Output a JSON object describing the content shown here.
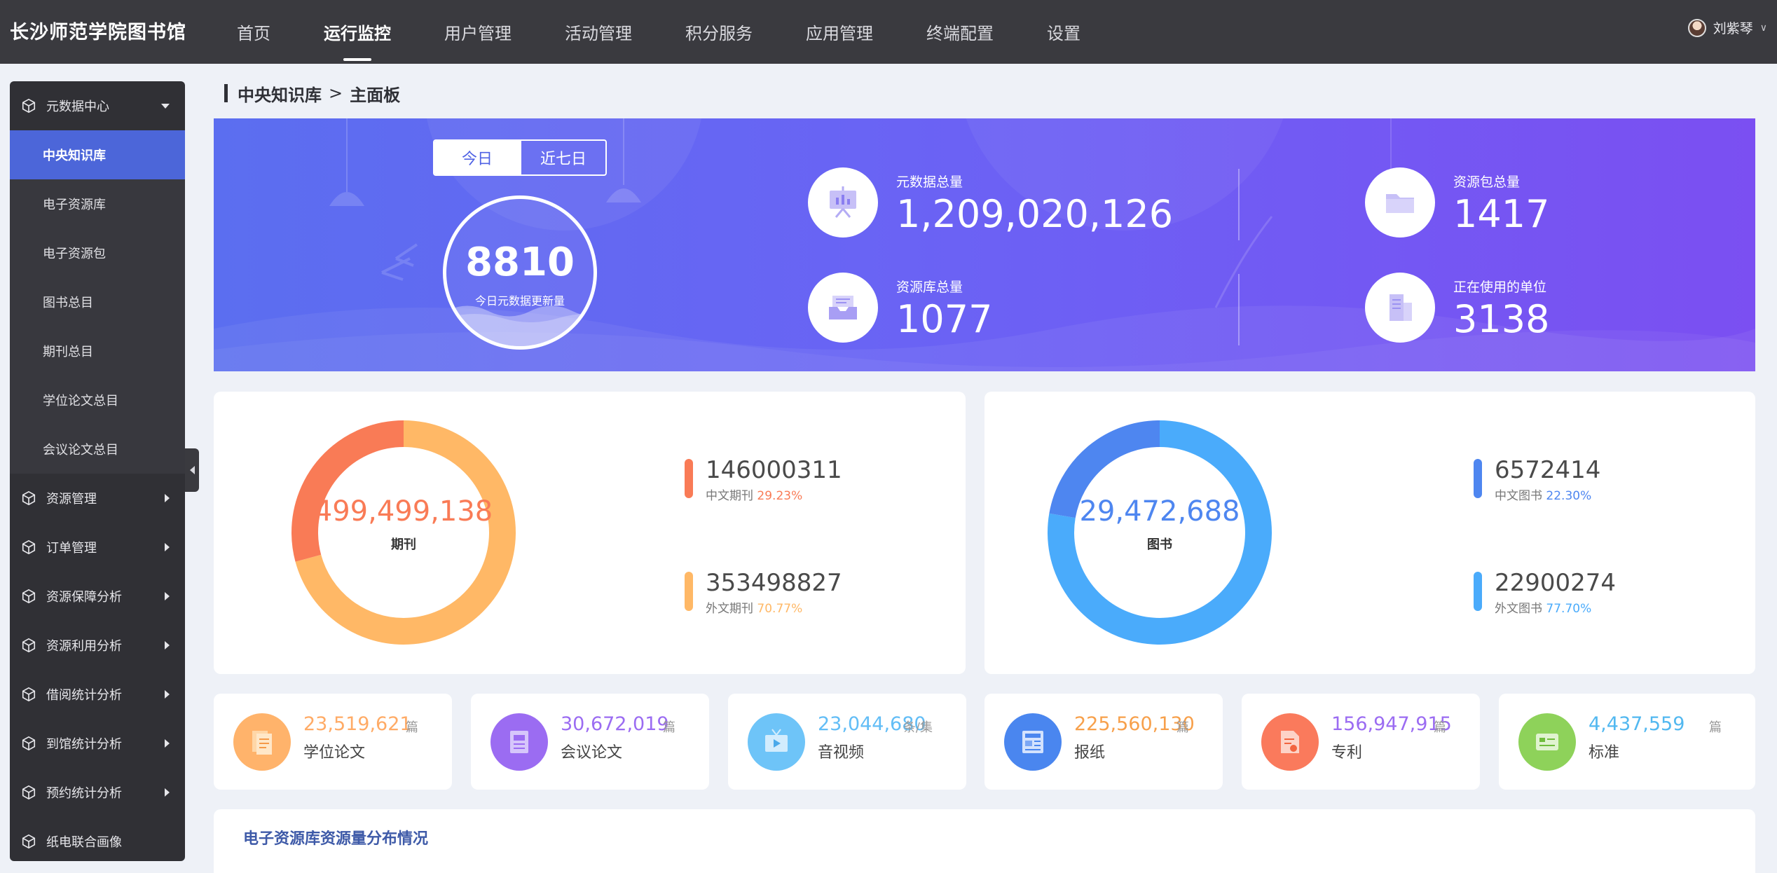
{
  "brand": "长沙师范学院图书馆",
  "nav": [
    "首页",
    "运行监控",
    "用户管理",
    "活动管理",
    "积分服务",
    "应用管理",
    "终端配置",
    "设置"
  ],
  "user": {
    "name": "刘紫琴"
  },
  "sidebar": {
    "group_open": "元数据中心",
    "sub_items": [
      "中央知识库",
      "电子资源库",
      "电子资源包",
      "图书总目",
      "期刊总目",
      "学位论文总目",
      "会议论文总目"
    ],
    "items": [
      "资源管理",
      "订单管理",
      "资源保障分析",
      "资源利用分析",
      "借阅统计分析",
      "到馆统计分析",
      "预约统计分析",
      "纸电联合画像"
    ]
  },
  "breadcrumb": {
    "parent": "中央知识库",
    "separator": ">",
    "current": "主面板"
  },
  "banner": {
    "tabs": [
      "今日",
      "近七日"
    ],
    "today_value": "8810",
    "today_label": "今日元数据更新量",
    "stats": [
      {
        "label": "元数据总量",
        "value": "1,209,020,126",
        "icon": "presentation-chart-icon"
      },
      {
        "label": "资源包总量",
        "value": "1417",
        "icon": "folder-icon"
      },
      {
        "label": "资源库总量",
        "value": "1077",
        "icon": "inbox-tray-icon"
      },
      {
        "label": "正在使用的单位",
        "value": "3138",
        "icon": "building-icon"
      }
    ]
  },
  "periodicals": {
    "total": "499,499,138",
    "label": "期刊",
    "colors": {
      "chinese": "#f97b56",
      "foreign": "#ffb866"
    },
    "chinese": {
      "value": "146000311",
      "name": "中文期刊",
      "pct": "29.23%",
      "fraction": 0.2923
    },
    "foreign": {
      "value": "353498827",
      "name": "外文期刊",
      "pct": "70.77%",
      "fraction": 0.7077
    }
  },
  "books": {
    "total": "29,472,688",
    "label": "图书",
    "colors": {
      "chinese": "#4e86f0",
      "foreign": "#4aabfb"
    },
    "chinese": {
      "value": "6572414",
      "name": "中文图书",
      "pct": "22.30%",
      "fraction": 0.223
    },
    "foreign": {
      "value": "22900274",
      "name": "外文图书",
      "pct": "77.70%",
      "fraction": 0.777
    }
  },
  "resources": [
    {
      "value": "23,519,621",
      "unit": "篇",
      "name": "学位论文",
      "color": "#ffab66",
      "icon": "document-icon"
    },
    {
      "value": "30,672,019",
      "unit": "篇",
      "name": "会议论文",
      "color": "#9b6cf2",
      "icon": "article-icon"
    },
    {
      "value": "23,044,680",
      "unit": "条/集",
      "name": "音视频",
      "color": "#62bdf6",
      "icon": "tv-icon"
    },
    {
      "value": "225,560,130",
      "unit": "篇",
      "name": "报纸",
      "color": "#f7a04b",
      "icon": "newspaper-icon"
    },
    {
      "value": "156,947,915",
      "unit": "篇",
      "name": "专利",
      "color": "#9b6cf2",
      "icon": "patent-icon"
    },
    {
      "value": "4,437,559",
      "unit": "篇",
      "name": "标准",
      "color": "#52b8f0",
      "icon": "standard-card-icon"
    }
  ],
  "resource_icon_colors": [
    "#ffb36b",
    "#9b6cf2",
    "#6ec4f8",
    "#4a86ef",
    "#fa7a5c",
    "#8ed25a"
  ],
  "distribution_title": "电子资源库资源量分布情况"
}
